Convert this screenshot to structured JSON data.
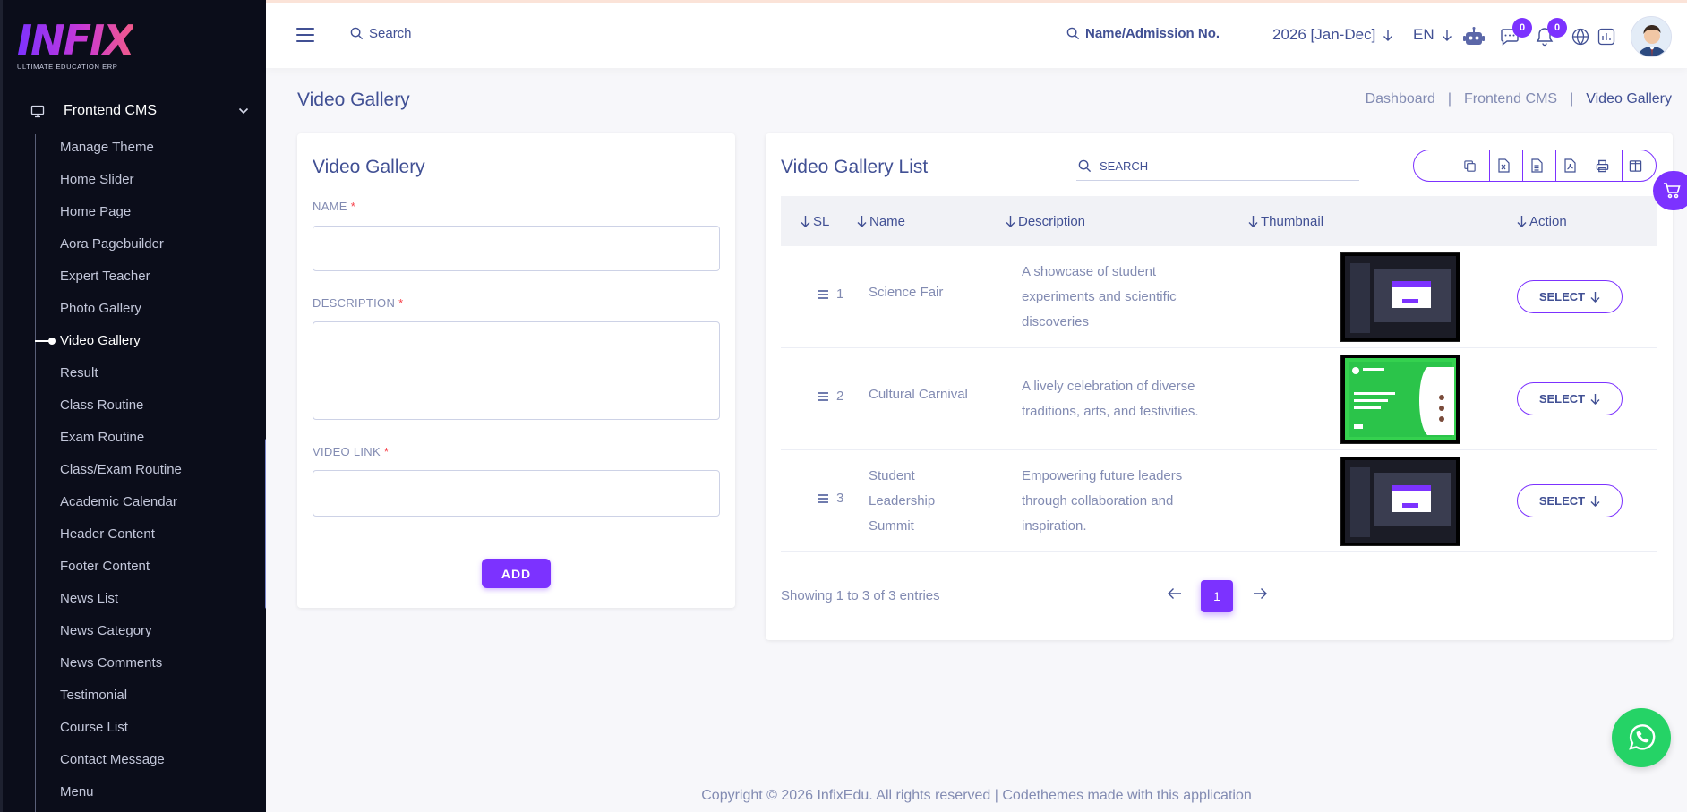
{
  "brand": {
    "logo_text": "INFIX",
    "tagline": "ULTIMATE EDUCATION ERP"
  },
  "sidebar": {
    "section": {
      "label": "Frontend CMS",
      "icon": "monitor-icon"
    },
    "items": [
      {
        "label": "Manage Theme"
      },
      {
        "label": "Home Slider"
      },
      {
        "label": "Home Page"
      },
      {
        "label": "Aora Pagebuilder"
      },
      {
        "label": "Expert Teacher"
      },
      {
        "label": "Photo Gallery"
      },
      {
        "label": "Video Gallery",
        "active": true
      },
      {
        "label": "Result"
      },
      {
        "label": "Class Routine"
      },
      {
        "label": "Exam Routine"
      },
      {
        "label": "Class/Exam Routine"
      },
      {
        "label": "Academic Calendar"
      },
      {
        "label": "Header Content"
      },
      {
        "label": "Footer Content"
      },
      {
        "label": "News List"
      },
      {
        "label": "News Category"
      },
      {
        "label": "News Comments"
      },
      {
        "label": "Testimonial"
      },
      {
        "label": "Course List"
      },
      {
        "label": "Contact Message"
      },
      {
        "label": "Menu"
      }
    ]
  },
  "topbar": {
    "search_placeholder": "Search",
    "student_search_placeholder": "Name/Admission No.",
    "academic_year": "2026 [Jan-Dec]",
    "language": "EN",
    "chat_badge": "0",
    "notification_badge": "0"
  },
  "page": {
    "title": "Video Gallery",
    "breadcrumb": [
      "Dashboard",
      "Frontend CMS",
      "Video Gallery"
    ]
  },
  "form": {
    "title": "Video Gallery",
    "name_label": "NAME",
    "description_label": "DESCRIPTION",
    "video_link_label": "VIDEO LINK",
    "required_mark": "*",
    "add_button": "ADD"
  },
  "list": {
    "title": "Video Gallery List",
    "search_placeholder": "SEARCH",
    "export_buttons": [
      "copy-icon",
      "excel-icon",
      "csv-icon",
      "pdf-icon",
      "print-icon",
      "columns-icon"
    ],
    "columns": [
      "SL",
      "Name",
      "Description",
      "Thumbnail",
      "Action"
    ],
    "rows": [
      {
        "sl": "1",
        "name": "Science Fair",
        "description": "A showcase of student experiments and scientific discoveries",
        "thumb": "dark",
        "action": "SELECT"
      },
      {
        "sl": "2",
        "name": "Cultural Carnival",
        "description": "A lively celebration of diverse traditions, arts, and festivities.",
        "thumb": "green",
        "action": "SELECT"
      },
      {
        "sl": "3",
        "name": "Student Leadership Summit",
        "description": "Empowering future leaders through collaboration and inspiration.",
        "thumb": "dark",
        "action": "SELECT"
      }
    ],
    "showing_text": "Showing 1 to 3 of 3 entries",
    "current_page": "1"
  },
  "footer": {
    "text": "Copyright © 2026 InfixEdu. All rights reserved | Codethemes made with this application"
  },
  "colors": {
    "accent": "#7c32ff",
    "text": "#415094",
    "muted": "#828bb2",
    "sidebar_bg": "#0b0d1a",
    "whatsapp": "#25d366"
  }
}
